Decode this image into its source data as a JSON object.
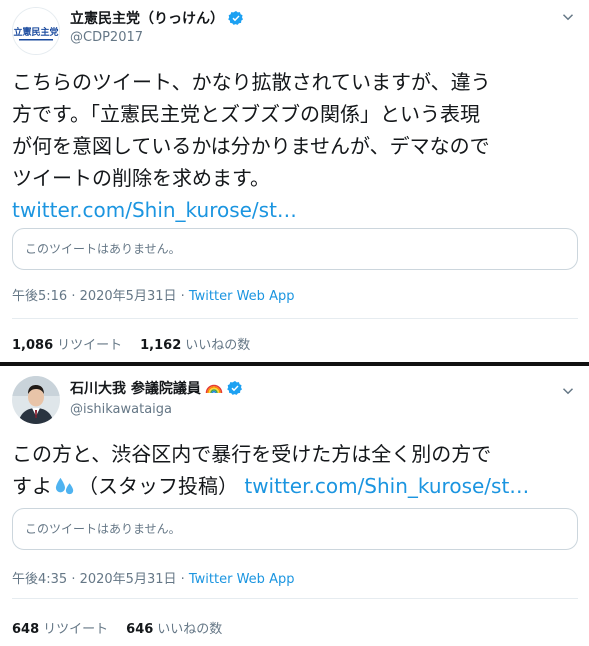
{
  "tweet1": {
    "display_name": "立憲民主党（りっけん）",
    "handle": "@CDP2017",
    "logo_text": "立憲民主党",
    "body_line1": "こちらのツイート、かなり拡散されていますが、違う",
    "body_line2": "方です。「立憲民主党とズブズブの関係」という表現",
    "body_line3": "が何を意図しているかは分かりませんが、デマなので",
    "body_line4": "ツイートの削除を求めます。",
    "link": "twitter.com/Shin_kurose/st…",
    "quote_unavailable": "このツイートはありません。",
    "time": "午後5:16 · 2020年5月31日 · ",
    "source": "Twitter Web App",
    "retweets_count": "1,086",
    "retweets_label": "リツイート",
    "likes_count": "1,162",
    "likes_label": "いいねの数"
  },
  "tweet2": {
    "display_name": "石川大我 参議院議員",
    "handle": "@ishikawataiga",
    "body_line1": "この方と、渋谷区内で暴行を受けた方は全く別の方で",
    "body_line2a": "すよ",
    "body_line2b": "（スタッフ投稿）",
    "link": "twitter.com/Shin_kurose/st…",
    "quote_unavailable": "このツイートはありません。",
    "time": "午後4:35 · 2020年5月31日 · ",
    "source": "Twitter Web App",
    "retweets_count": "648",
    "retweets_label": "リツイート",
    "likes_count": "646",
    "likes_label": "いいねの数"
  },
  "colors": {
    "link": "#1b95e0",
    "verified": "#1da1f2",
    "secondary_text": "#657786",
    "primary_text": "#14171a",
    "logo_blue": "#1a4a9e"
  }
}
